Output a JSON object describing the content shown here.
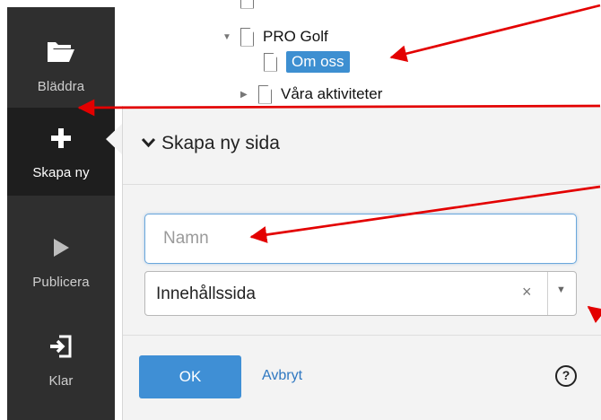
{
  "sidebar": {
    "items": [
      {
        "label": "Bläddra",
        "icon": "folder-icon"
      },
      {
        "label": "Skapa ny",
        "icon": "plus-icon"
      },
      {
        "label": "Publicera",
        "icon": "play-icon"
      },
      {
        "label": "Klar",
        "icon": "exit-icon"
      }
    ],
    "colors": {
      "background": "#2f2f2f",
      "active": "#1e1e1e"
    }
  },
  "tree": {
    "items": [
      {
        "label": "PRO Golf",
        "expanded": true
      },
      {
        "label": "Om oss",
        "selected": true
      },
      {
        "label": "Våra aktiviteter",
        "expanded": false
      }
    ]
  },
  "panel": {
    "title": "Skapa ny sida",
    "name_placeholder": "Namn",
    "page_type_value": "Innehållssida",
    "ok_label": "OK",
    "cancel_label": "Avbryt",
    "help_glyph": "?"
  },
  "colors": {
    "accent": "#3f8fd5",
    "selection": "#3d8fd1",
    "annotation_arrow": "#e30000"
  }
}
